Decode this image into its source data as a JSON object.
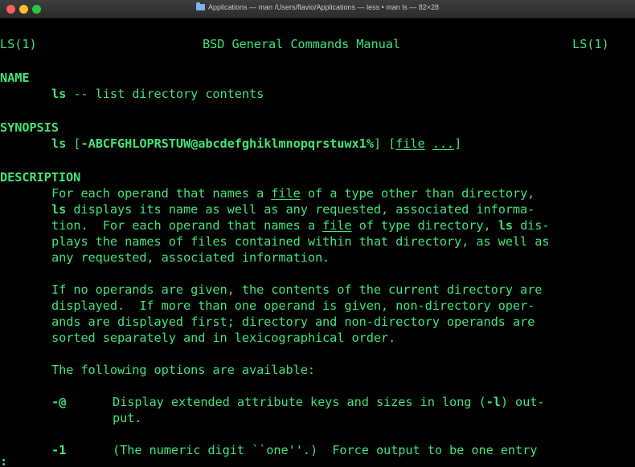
{
  "window": {
    "title": "Applications — man /Users/flavio/Applications — less • man ls — 82×28",
    "buttons": {
      "close": "close",
      "minimize": "minimize",
      "zoom": "zoom"
    }
  },
  "man": {
    "header_left": "LS(1)",
    "header_center": "BSD General Commands Manual",
    "header_right": "LS(1)",
    "name_heading": "NAME",
    "name_cmd": "ls",
    "name_desc": " -- list directory contents",
    "synopsis_heading": "SYNOPSIS",
    "synopsis_cmd": "ls",
    "synopsis_open": " [",
    "synopsis_flags": "-ABCFGHLOPRSTUW@abcdefghiklmnopqrstuwx1%",
    "synopsis_mid": "] [",
    "synopsis_file": "file",
    "synopsis_space": " ",
    "synopsis_ellipsis": "...",
    "synopsis_close": "]",
    "description_heading": "DESCRIPTION",
    "d1_a": "For each operand that names a ",
    "d1_file": "file",
    "d1_b": " of a type other than directory,",
    "d2_ls": "ls",
    "d2_b": " displays its name as well as any requested, associated informa-",
    "d3_a": "tion.  For each operand that names a ",
    "d3_file": "file",
    "d3_b": " of type directory, ",
    "d3_ls": "ls",
    "d3_c": " dis-",
    "d4": "plays the names of files contained within that directory, as well as",
    "d5": "any requested, associated information.",
    "p2_1": "If no operands are given, the contents of the current directory are",
    "p2_2": "displayed.  If more than one operand is given, non-directory oper-",
    "p2_3": "ands are displayed first; directory and non-directory operands are",
    "p2_4": "sorted separately and in lexicographical order.",
    "p3": "The following options are available:",
    "opt_at_flag": "-@",
    "opt_at_desc_a": "Display extended attribute keys and sizes in long (",
    "opt_at_desc_flag": "-l",
    "opt_at_desc_b": ") out-",
    "opt_at_desc2": "put.",
    "opt_1_flag": "-1",
    "opt_1_desc": "(The numeric digit ``one''.)  Force output to be one entry"
  },
  "prompt": ":"
}
